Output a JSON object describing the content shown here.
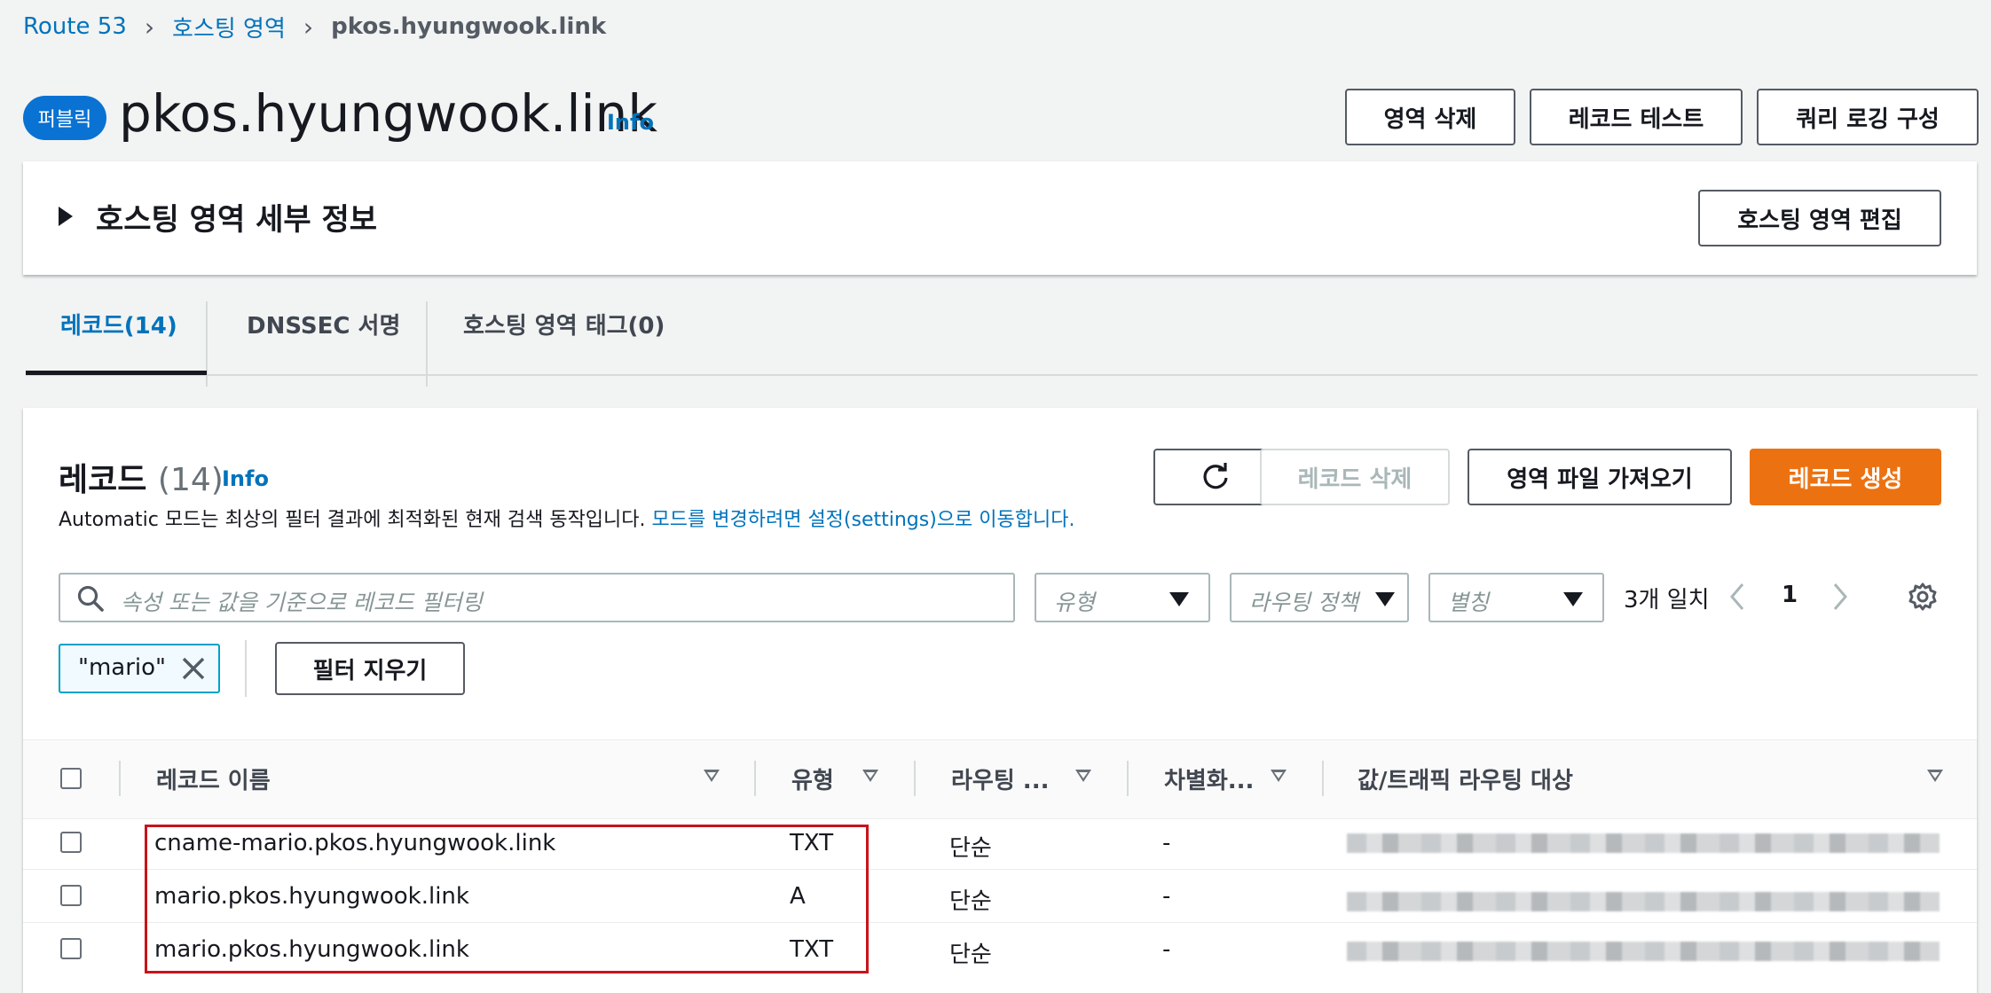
{
  "breadcrumb": {
    "root": "Route 53",
    "level2": "호스팅 영역",
    "current": "pkos.hyungwook.link"
  },
  "header": {
    "badge": "퍼블릭",
    "title": "pkos.hyungwook.link",
    "info": "Info",
    "buttons": {
      "delete_zone": "영역 삭제",
      "test_record": "레코드 테스트",
      "query_logging": "쿼리 로깅 구성"
    }
  },
  "details": {
    "title": "호스팅 영역 세부 정보",
    "edit_button": "호스팅 영역 편집"
  },
  "tabs": [
    {
      "label": "레코드(14)",
      "active": true
    },
    {
      "label": "DNSSEC 서명",
      "active": false
    },
    {
      "label": "호스팅 영역 태그(0)",
      "active": false
    }
  ],
  "records": {
    "title": "레코드",
    "count": "(14)",
    "info": "Info",
    "desc_plain": "Automatic 모드는 최상의 필터 결과에 최적화된 현재 검색 동작입니다.",
    "desc_link": "모드를 변경하려면 설정(settings)으로 이동합니다.",
    "buttons": {
      "delete": "레코드 삭제",
      "import": "영역 파일 가져오기",
      "create": "레코드 생성"
    },
    "search_placeholder": "속성 또는 값을 기준으로 레코드 필터링",
    "filters": {
      "type": "유형",
      "routing": "라우팅 정책",
      "alias": "별칭"
    },
    "matches": "3개 일치",
    "page": "1",
    "token": "\"mario\"",
    "clear_filters": "필터 지우기",
    "columns": [
      "레코드 이름",
      "유형",
      "라우팅 ...",
      "차별화...",
      "값/트래픽 라우팅 대상"
    ],
    "rows": [
      {
        "name": "cname-mario.pkos.hyungwook.link",
        "type": "TXT",
        "routing": "단순",
        "diff": "-"
      },
      {
        "name": "mario.pkos.hyungwook.link",
        "type": "A",
        "routing": "단순",
        "diff": "-"
      },
      {
        "name": "mario.pkos.hyungwook.link",
        "type": "TXT",
        "routing": "단순",
        "diff": "-"
      }
    ]
  },
  "colors": {
    "link": "#0073bb",
    "primary": "#ec7211",
    "highlight": "#c7141a",
    "badge": "#0972d3"
  }
}
